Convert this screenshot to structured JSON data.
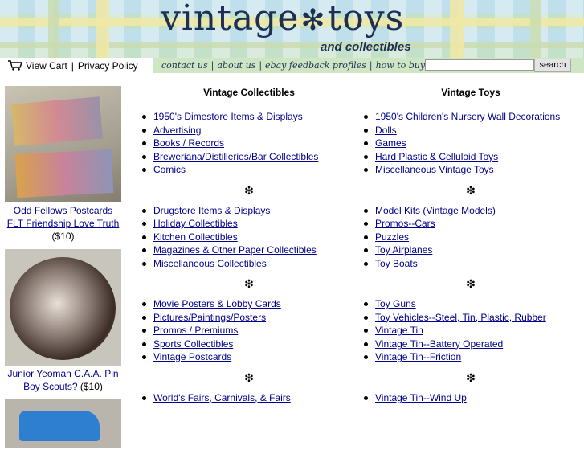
{
  "header": {
    "logo_left": "vintage",
    "logo_star": "✻",
    "logo_right": "toys",
    "tagline": "and collectibles"
  },
  "leftnav": {
    "cart_label": "View Cart",
    "separator": "|",
    "privacy_label": "Privacy Policy"
  },
  "navbar": {
    "links": [
      "contact us",
      "about us",
      "ebay feedback profiles",
      "how to buy"
    ],
    "search_value": "",
    "search_button": "search"
  },
  "sidebar": {
    "products": [
      {
        "title_line1": "Odd Fellows Postcards",
        "title_line2": "FLT Friendship Love Truth",
        "price": "($10)"
      },
      {
        "title_line1": "Junior Yeoman C.A.A. Pin",
        "title_line2": "Boy Scouts?",
        "price": "($10)"
      }
    ]
  },
  "columns": [
    {
      "heading": "Vintage Collectibles",
      "groups": [
        [
          "1950's Dimestore Items & Displays",
          "Advertising",
          "Books / Records",
          "Breweriana/Distilleries/Bar Collectibles",
          "Comics"
        ],
        [
          "Drugstore Items & Displays",
          "Holiday Collectibles",
          "Kitchen Collectibles",
          "Magazines & Other Paper Collectibles",
          "Miscellaneous Collectibles"
        ],
        [
          "Movie Posters & Lobby Cards",
          "Pictures/Paintings/Posters",
          "Promos / Premiums",
          "Sports Collectibles",
          "Vintage Postcards"
        ],
        [
          "World's Fairs, Carnivals, & Fairs"
        ]
      ]
    },
    {
      "heading": "Vintage Toys",
      "groups": [
        [
          "1950's Children's Nursery Wall Decorations",
          "Dolls",
          "Games",
          "Hard Plastic & Celluloid Toys",
          "Miscellaneous Vintage Toys"
        ],
        [
          "Model Kits (Vintage Models)",
          "Promos--Cars",
          "Puzzles",
          "Toy Airplanes",
          "Toy Boats"
        ],
        [
          "Toy Guns",
          "Toy Vehicles--Steel, Tin, Plastic, Rubber",
          "Vintage Tin",
          "Vintage Tin--Battery Operated",
          "Vintage Tin--Friction"
        ],
        [
          "Vintage Tin--Wind Up"
        ]
      ]
    }
  ],
  "divider_symbol": "❇",
  "colors": {
    "banner": "#bfe0ea",
    "navbar": "#cfe6c4",
    "link": "#00008b",
    "logo": "#1d2f55"
  },
  "icons": [
    "cart-icon"
  ]
}
